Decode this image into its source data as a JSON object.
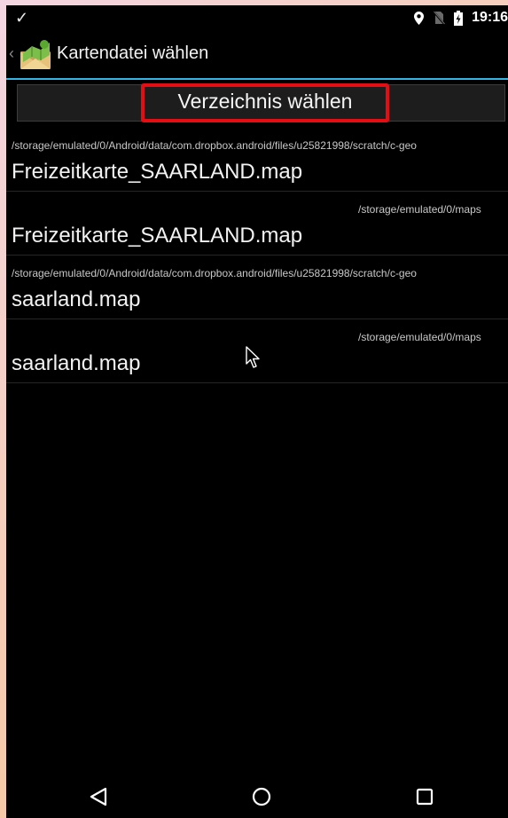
{
  "status_bar": {
    "time": "19:16",
    "left_icon": "check-icon",
    "right_icons": [
      "location-icon",
      "no-sim-icon",
      "battery-charging-icon"
    ]
  },
  "action_bar": {
    "title": "Kartendatei wählen",
    "app_icon": "map-app-icon"
  },
  "directory_button": {
    "label": "Verzeichnis wählen",
    "highlight_color": "#e20e14"
  },
  "files": [
    {
      "path": "/storage/emulated/0/Android/data/com.dropbox.android/files/u25821998/scratch/c-geo",
      "name": "Freizeitkarte_SAARLAND.map",
      "path_align": "left"
    },
    {
      "path": "/storage/emulated/0/maps",
      "name": "Freizeitkarte_SAARLAND.map",
      "path_align": "right"
    },
    {
      "path": "/storage/emulated/0/Android/data/com.dropbox.android/files/u25821998/scratch/c-geo",
      "name": "saarland.map",
      "path_align": "left"
    },
    {
      "path": "/storage/emulated/0/maps",
      "name": "saarland.map",
      "path_align": "right"
    }
  ],
  "nav_bar": {
    "icons": [
      "back-triangle-icon",
      "home-circle-icon",
      "recent-apps-square-icon"
    ]
  },
  "colors": {
    "accent": "#33b5e5",
    "background": "#000000"
  }
}
